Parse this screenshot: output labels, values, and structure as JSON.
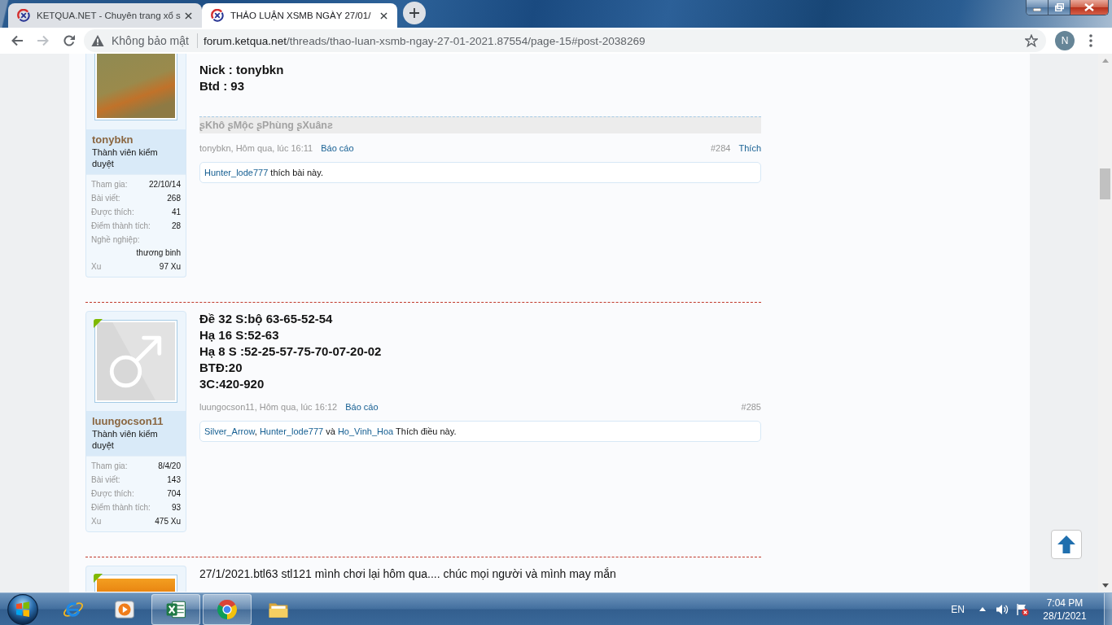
{
  "browser": {
    "tabs": [
      {
        "title": "KETQUA.NET - Chuyên trang xổ s",
        "selected": false
      },
      {
        "title": "THẢO LUẬN XSMB NGÀY 27/01/",
        "selected": true
      }
    ],
    "nav": [
      {
        "kind": "back",
        "disabled": false
      },
      {
        "kind": "forward",
        "disabled": true
      },
      {
        "kind": "reload",
        "disabled": false
      }
    ],
    "security_label": "Không bảo mật",
    "url": {
      "host": "forum.ketqua.net",
      "path": "/threads/thao-luan-xsmb-ngay-27-01-2021.87554/page-15#post-2038269"
    },
    "profile_initial": "N"
  },
  "posts": [
    {
      "user": {
        "name": "tonybkn",
        "role": "Thành viên kiểm duyệt",
        "avatar": {
          "kind": "photo"
        },
        "stats": [
          {
            "kind": "pair",
            "label": "Tham gia:",
            "value": "22/10/14"
          },
          {
            "kind": "pair",
            "label": "Bài viết:",
            "value": "268"
          },
          {
            "kind": "pair",
            "label": "Được thích:",
            "value": "41"
          },
          {
            "kind": "pair",
            "label": "Điểm thành tích:",
            "value": "28"
          },
          {
            "kind": "stacked",
            "label": "Nghề nghiệp:",
            "value": "thương binh"
          },
          {
            "kind": "pair",
            "label": "Xu",
            "value": "97 Xu"
          }
        ]
      },
      "body": {
        "bold": true,
        "lines": [
          "Nick : tonybkn",
          "Btd : 93"
        ]
      },
      "signature": "ʂKhô ʂMộc ʂPhùng ʂXuânƨ",
      "meta": {
        "byline": "tonybkn, Hôm qua, lúc 16:11",
        "report": "Báo cáo",
        "number": "#284",
        "like": "Thích"
      },
      "likes": [
        {
          "kind": "link",
          "text": "Hunter_lode777"
        },
        {
          "kind": "text",
          "text": " thích bài này."
        }
      ]
    },
    {
      "user": {
        "name": "luungocson11",
        "role": "Thành viên kiểm duyệt",
        "online": true,
        "avatar": {
          "kind": "default"
        },
        "stats": [
          {
            "kind": "pair",
            "label": "Tham gia:",
            "value": "8/4/20"
          },
          {
            "kind": "pair",
            "label": "Bài viết:",
            "value": "143"
          },
          {
            "kind": "pair",
            "label": "Được thích:",
            "value": "704"
          },
          {
            "kind": "pair",
            "label": "Điểm thành tích:",
            "value": "93"
          },
          {
            "kind": "pair",
            "label": "Xu",
            "value": "475 Xu"
          }
        ]
      },
      "body": {
        "bold": true,
        "lines": [
          "Đề 32 S:bộ 63-65-52-54",
          "Hạ 16 S:52-63",
          "Hạ 8 S :52-25-57-75-70-07-20-02",
          "BTĐ:20",
          "3C:420-920"
        ]
      },
      "meta": {
        "byline": "luungocson11, Hôm qua, lúc 16:12",
        "report": "Báo cáo",
        "number": "#285"
      },
      "likes": [
        {
          "kind": "link",
          "text": "Silver_Arrow"
        },
        {
          "kind": "text",
          "text": ", "
        },
        {
          "kind": "link",
          "text": "Hunter_lode777"
        },
        {
          "kind": "text",
          "text": " và "
        },
        {
          "kind": "link",
          "text": "Ho_Vinh_Hoa"
        },
        {
          "kind": "text",
          "text": " Thích điều này."
        }
      ]
    },
    {
      "user": {
        "online": true,
        "avatar": {
          "kind": "photo"
        }
      },
      "body": {
        "bold": false,
        "lines": [
          "27/1/2021.btl63 stl121 mình chơi lại hôm qua.... chúc mọi người và mình may mắn"
        ]
      }
    }
  ],
  "taskbar": {
    "apps": [
      {
        "kind": "browser-e",
        "running": false
      },
      {
        "kind": "media",
        "running": false
      },
      {
        "kind": "spreadsheet",
        "running": true
      },
      {
        "kind": "browser-wheel",
        "running": true
      },
      {
        "kind": "folder",
        "running": false
      }
    ],
    "language": "EN",
    "clock": {
      "time": "7:04 PM",
      "date": "28/1/2021"
    }
  }
}
